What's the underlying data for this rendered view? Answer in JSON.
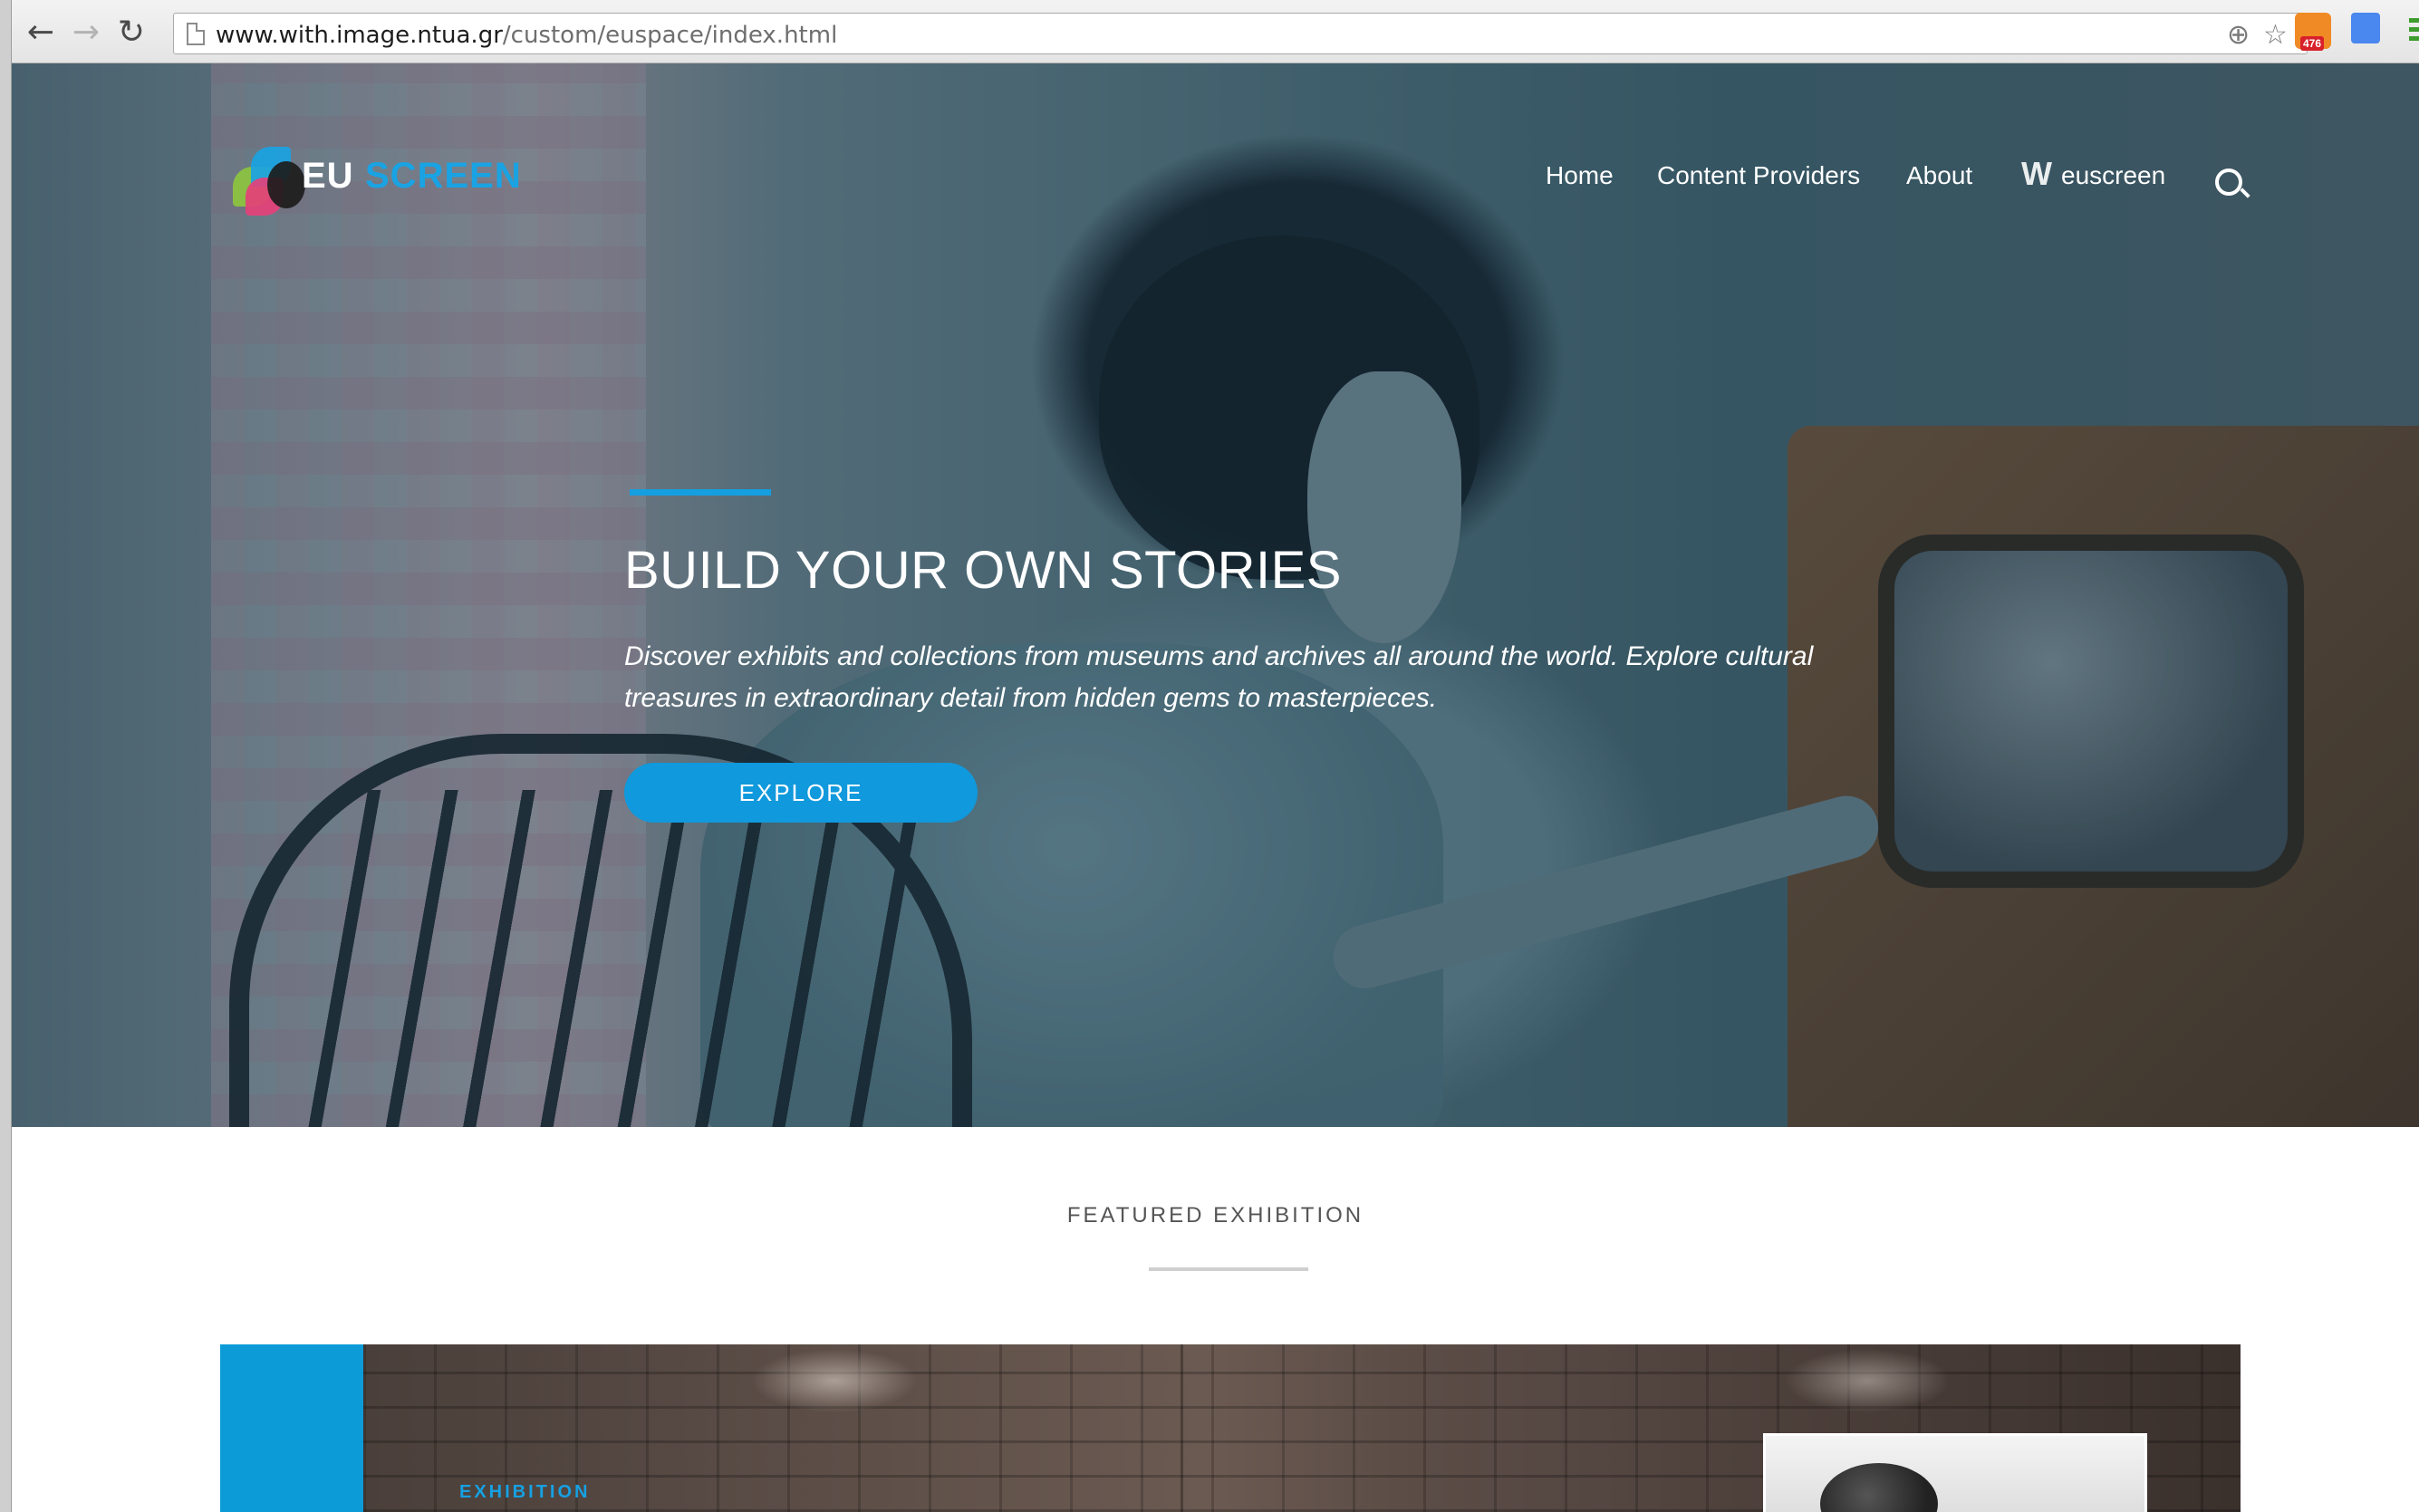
{
  "browser": {
    "url_host": "www.with.image.ntua.gr",
    "url_path": "/custom/euspace/index.html",
    "back_icon": "←",
    "forward_icon": "→",
    "reload_icon": "↻",
    "zoom_icon": "⊕",
    "bookmark_icon": "☆",
    "rss_badge_count": "476"
  },
  "site": {
    "logo": {
      "eu": "EU",
      "screen": "SCREEN",
      "colors": {
        "accent": "#1aa3e3"
      }
    },
    "nav": {
      "home": "Home",
      "content_providers": "Content Providers",
      "about": "About",
      "euscreen": "euscreen"
    }
  },
  "hero": {
    "title": "BUILD YOUR OWN STORIES",
    "description": "Discover exhibits and collections from museums and archives all around the world. Explore cultural treasures in extraordinary detail from hidden gems to masterpieces.",
    "cta_label": "EXPLORE",
    "accent_color": "#149fe0"
  },
  "featured": {
    "section_title": "FEATURED EXHIBITION",
    "card_label": "EXHIBITION"
  }
}
